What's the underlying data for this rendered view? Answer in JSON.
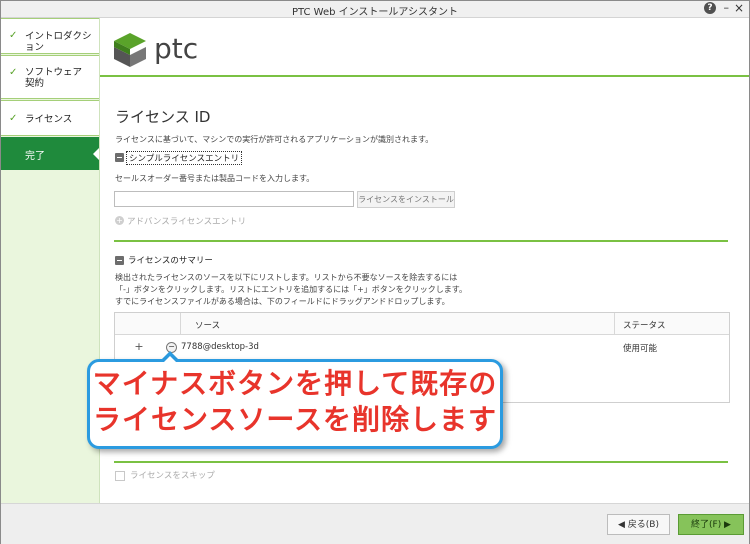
{
  "window": {
    "title": "PTC Web インストールアシスタント",
    "help_label": "?",
    "minimize_label": "–",
    "close_label": "×"
  },
  "sidebar": {
    "items": [
      {
        "label": "イントロダクション",
        "checked": true
      },
      {
        "label_line1": "ソフトウェア",
        "label_line2": "契約",
        "checked": true
      },
      {
        "label": "ライセンス",
        "checked": true
      },
      {
        "label": "完了",
        "active": true
      }
    ]
  },
  "logo": {
    "text": "ptc"
  },
  "page": {
    "heading": "ライセンス ID",
    "description": "ライセンスに基づいて、マシンでの実行が許可されるアプリケーションが識別されます。",
    "simple": {
      "label": "シンプルライセンスエントリ",
      "instruction": "セールスオーダー番号または製品コードを入力します。",
      "input_value": "",
      "install_button": "ライセンスをインストール"
    },
    "advanced": {
      "label": "アドバンスライセンスエントリ"
    },
    "summary": {
      "label": "ライセンスのサマリー",
      "lines": [
        "検出されたライセンスのソースを以下にリストします。リストから不要なソースを除去するには",
        "「-」ボタンをクリックします。リストにエントリを追加するには「+」ボタンをクリックします。",
        "すでにライセンスファイルがある場合は、下のフィールドにドラッグアンドドロップします。"
      ],
      "columns": {
        "source": "ソース",
        "status": "ステータス"
      },
      "rows": [
        {
          "plus": "+",
          "minus": "−",
          "source": "7788@desktop-3d",
          "status": "使用可能"
        }
      ]
    },
    "skip_label": "ライセンスをスキップ"
  },
  "callout": {
    "line1": "マイナスボタンを押して既存の",
    "line2": "ライセンスソースを削除します"
  },
  "footer": {
    "back_label": "◀ 戻る(B)",
    "finish_label": "終了(F) ▶"
  },
  "colors": {
    "accent_green": "#7ac143",
    "active_item": "#1f8a3c",
    "callout_border": "#2b9be0",
    "callout_text": "#e8342b"
  }
}
